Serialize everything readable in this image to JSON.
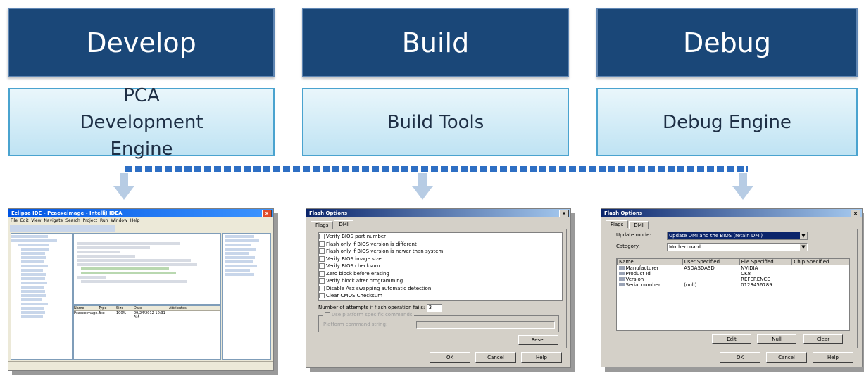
{
  "phases": [
    {
      "title": "Develop",
      "tool": "PCA Development Engine"
    },
    {
      "title": "Build",
      "tool": "Build Tools"
    },
    {
      "title": "Debug",
      "tool": "Debug Engine"
    }
  ],
  "ide_screenshot": {
    "title": "Eclipse IDE - Pcaexeimage - IntelliJ IDEA",
    "menu": [
      "File",
      "Edit",
      "View",
      "Navigate",
      "Search",
      "Project",
      "Run",
      "Window",
      "Help"
    ],
    "bottom_table": {
      "headers": [
        "Name",
        "Type",
        "Size",
        "Date",
        "Attributes"
      ],
      "rows": [
        [
          "Pcaexeimage.exe",
          "A",
          "100%",
          "09/24/2012 10:31 AM",
          ""
        ]
      ]
    }
  },
  "flags_dialog": {
    "title": "Flash Options",
    "tabs": [
      "Flags",
      "DMI"
    ],
    "options": [
      "Verify BIOS part number",
      "Flash only if BIOS version is different",
      "Flash only if BIOS version is newer than system",
      "Verify BIOS image size",
      "Verify BIOS checksum",
      "Zero block before erasing",
      "Verify block after programming",
      "Disable Asx swapping automatic detection",
      "Clear CMOS Checksum"
    ],
    "attempts_label": "Number of attempts if flash operation fails:",
    "attempts_value": "3",
    "platform_checkbox": "Use platform specific commands",
    "platform_label": "Platform command string:",
    "reset_button": "Reset",
    "ok_button": "OK",
    "cancel_button": "Cancel",
    "help_button": "Help"
  },
  "dmi_dialog": {
    "title": "Flash Options",
    "tabs": [
      "Flags",
      "DMI"
    ],
    "update_mode_label": "Update mode:",
    "update_mode_value": "Update DMI and the BIOS (retain DMI)",
    "category_label": "Category:",
    "category_value": "Motherboard",
    "headers": [
      "Name",
      "User Specified",
      "File Specified",
      "Chip Specified"
    ],
    "rows": [
      [
        "Manufacturer",
        "ASDASDASD",
        "NVIDIA",
        ""
      ],
      [
        "Product Id",
        "",
        "CK8",
        ""
      ],
      [
        "Version",
        "",
        "REFERENCE",
        ""
      ],
      [
        "Serial number",
        "(null)",
        "0123456789",
        ""
      ]
    ],
    "edit_button": "Edit",
    "null_button": "Null",
    "clear_button": "Clear",
    "ok_button": "OK",
    "cancel_button": "Cancel",
    "help_button": "Help"
  },
  "colors": {
    "phase_box": "#1a4778",
    "tool_box_top": "#e9f6fb",
    "tool_box_bottom": "#bfe3f3",
    "connector_dots": "#2e6fc4",
    "arrows": "#b7cce4"
  },
  "icons": [
    "down-arrow-icon",
    "checkbox-icon",
    "dropdown-arrow-icon",
    "close-icon"
  ]
}
